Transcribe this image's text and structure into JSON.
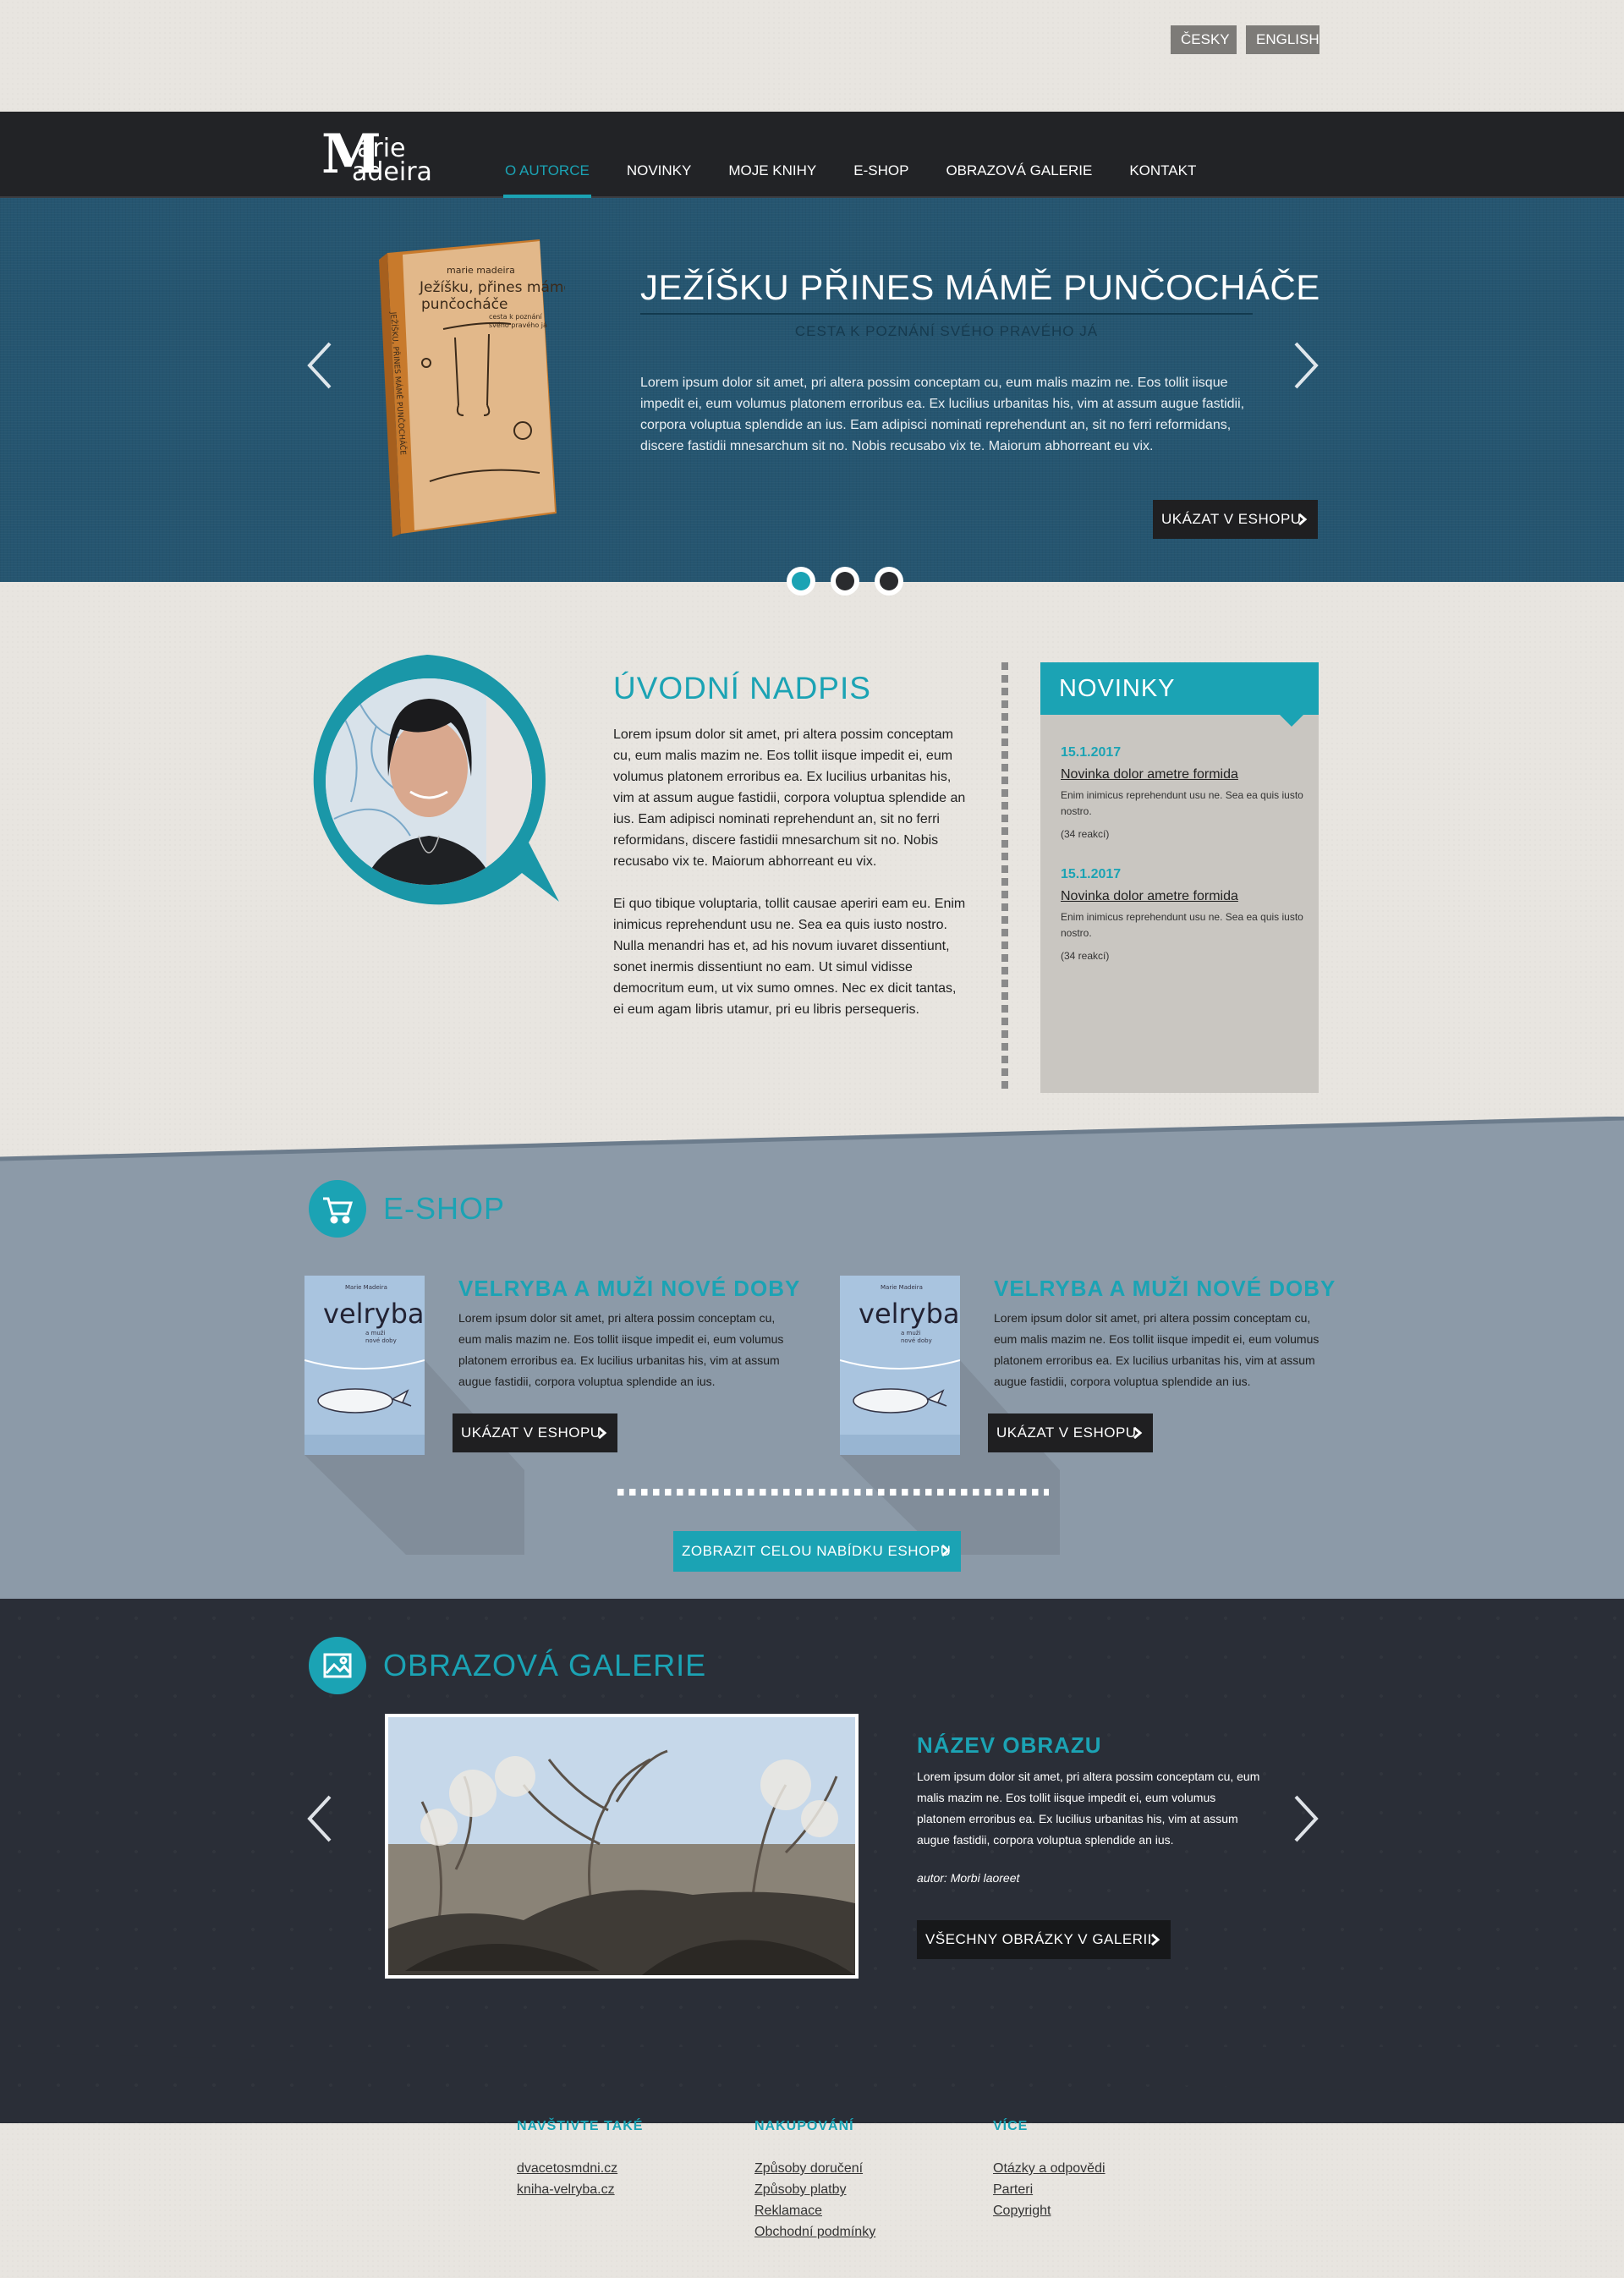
{
  "lang": {
    "cs": "ČESKY",
    "en": "ENGLISH"
  },
  "logo": {
    "letter": "M",
    "word1": "arie",
    "word2": "adeira"
  },
  "nav": [
    "O AUTORCE",
    "NOVINKY",
    "MOJE KNIHY",
    "E-SHOP",
    "OBRAZOVÁ GALERIE",
    "KONTAKT"
  ],
  "nav_active": "O AUTORCE",
  "hero": {
    "title": "JEŽÍŠKU PŘINES MÁMĚ PUNČOCHÁČE",
    "subtitle": "CESTA K POZNÁNÍ SVÉHO PRAVÉHO JÁ",
    "text": "Lorem ipsum dolor sit amet, pri altera possim conceptam cu, eum malis mazim ne. Eos tollit iisque impedit ei, eum volumus platonem erroribus ea. Ex lucilius urbanitas his, vim at assum augue fastidii, corpora voluptua splendide an ius. Eam adipisci nominati reprehendunt an, sit no ferri reformidans, discere fastidii mnesarchum sit no. Nobis recusabo vix te. Maiorum abhorreant eu vix.",
    "button": "UKÁZAT V ESHOPU",
    "book": {
      "author": "marie madeira",
      "title_line1": "Ježíšku, přines mámě",
      "title_line2": "punčocháče",
      "subtitle_line1": "cesta k poznání",
      "subtitle_line2": "svého pravého já",
      "spine": "JEŽÍŠKU, PŘINES MÁMĚ PUNČOCHÁČE"
    },
    "slides": 3,
    "active_slide": 1
  },
  "intro": {
    "title": "ÚVODNÍ NADPIS",
    "p1": "Lorem ipsum dolor sit amet, pri altera possim conceptam cu, eum malis mazim ne. Eos tollit iisque impedit ei, eum volumus platonem erroribus ea. Ex lucilius urbanitas his, vim at assum augue fastidii, corpora voluptua splendide an ius. Eam adipisci nominati reprehendunt an, sit no ferri reformidans, discere fastidii mnesarchum sit no. Nobis recusabo vix te. Maiorum abhorreant eu vix.",
    "p2": "Ei quo tibique voluptaria, tollit causae aperiri eam eu. Enim inimicus reprehendunt usu ne. Sea ea quis iusto nostro. Nulla menandri has et, ad his novum iuvaret dissentiunt, sonet inermis dissentiunt no eam. Ut simul vidisse democritum eum, ut vix sumo omnes. Nec ex dicit tantas, ei eum agam libris utamur, pri eu libris persequeris."
  },
  "news": {
    "heading": "NOVINKY",
    "items": [
      {
        "date": "15.1.2017",
        "title": "Novinka  dolor ametre formida",
        "text": "Enim inimicus reprehendunt usu ne. Sea ea quis iusto nostro.",
        "reactions": "(34 reakcí)"
      },
      {
        "date": "15.1.2017",
        "title": "Novinka  dolor ametre formida",
        "text": "Enim inimicus reprehendunt usu ne. Sea ea quis iusto nostro.",
        "reactions": "(34 reakcí)"
      }
    ]
  },
  "eshop": {
    "title": "E-SHOP",
    "products": [
      {
        "title": "VELRYBA A MUŽI NOVÉ DOBY",
        "text": "Lorem ipsum dolor sit amet, pri altera possim conceptam cu, eum malis mazim ne. Eos tollit iisque impedit ei, eum volumus platonem erroribus ea. Ex lucilius urbanitas his, vim at assum augue fastidii, corpora voluptua splendide an ius.",
        "button": "UKÁZAT V ESHOPU",
        "cover_author": "Marie Madeira",
        "cover_title": "velryba",
        "cover_sub1": "a muži",
        "cover_sub2": "nové doby"
      },
      {
        "title": "VELRYBA A MUŽI NOVÉ DOBY",
        "text": "Lorem ipsum dolor sit amet, pri altera possim conceptam cu, eum malis mazim ne. Eos tollit iisque impedit ei, eum volumus platonem erroribus ea. Ex lucilius urbanitas his, vim at assum augue fastidii, corpora voluptua splendide an ius.",
        "button": "UKÁZAT V ESHOPU",
        "cover_author": "Marie Madeira",
        "cover_title": "velryba",
        "cover_sub1": "a muži",
        "cover_sub2": "nové doby"
      }
    ],
    "all_button": "ZOBRAZIT CELOU NABÍDKU ESHOPU"
  },
  "gallery": {
    "title": "OBRAZOVÁ GALERIE",
    "image_title": "NÁZEV OBRAZU",
    "text": "Lorem ipsum dolor sit amet, pri altera possim conceptam cu, eum malis mazim ne. Eos tollit iisque impedit ei, eum volumus platonem erroribus ea. Ex lucilius urbanitas his, vim at assum augue fastidii, corpora voluptua splendide an ius.",
    "author": "autor: Morbi laoreet",
    "button": "VŠECHNY OBRÁZKY V GALERII"
  },
  "footer": {
    "cols": [
      {
        "heading": "NAVŠTIVTE TAKÉ",
        "links": [
          "dvacetosmdni.cz",
          "kniha-velryba.cz"
        ]
      },
      {
        "heading": "NAKUPOVÁNÍ",
        "links": [
          "Způsoby doručení",
          "Způsoby platby",
          "Reklamace",
          "Obchodní podmínky"
        ]
      },
      {
        "heading": "VÍCE",
        "links": [
          "Otázky a odpovědi",
          "Parteri",
          "Copyright"
        ]
      }
    ]
  },
  "colors": {
    "accent": "#1ba3b4",
    "header": "#222326",
    "hero": "#255570",
    "eshop": "#8c9aa8",
    "gallery": "#2a2e37",
    "paper": "#e8e5e0"
  }
}
